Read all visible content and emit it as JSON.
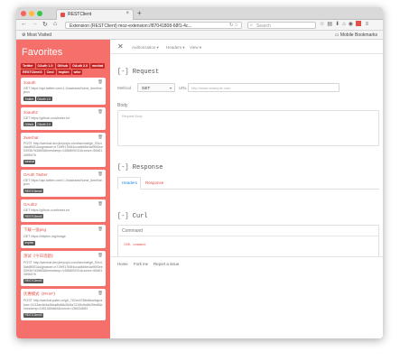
{
  "browser": {
    "tab_title": "RESTClient",
    "tab_close": "×",
    "new_tab": "+",
    "url": "Extension (RESTClient)   moz-extension://87041808-68f1-4c...",
    "search_placeholder": "Search",
    "bookmarks_left": "Most Visited",
    "bookmarks_right": "Mobile Bookmarks",
    "colors": {
      "close": "#fc605c",
      "minimize": "#fdbc40",
      "maximize": "#34c84a"
    }
  },
  "sidebar": {
    "title": "Favorites",
    "tags": [
      "Twitter",
      "OAuth 1.0",
      "Github",
      "OAuth 2.0",
      "wechat",
      "RESTClient3",
      "Cmd",
      "tmpbin",
      "wike"
    ],
    "items": [
      {
        "name": "3oauth",
        "desc": "GET https://api.twitter.com/1.1/statuses/home_timeline.json",
        "tags": [
          "Twitter",
          "OAuth 1.0"
        ]
      },
      {
        "name": "3oauth2",
        "desc": "GET https://github.com/index.txt",
        "tags": [
          "Github",
          "OAuth 2.0"
        ]
      },
      {
        "name": "3wechat",
        "desc": "POST http://wechat.dev.jimyrojiu.com/wechat/gh_93c45ab8f051&signature=e719f917b5f4ccad6b6e4a9f0f3ee0393b7d3d60&timestamp=1456809241&nonce=564613d9607b",
        "tags": [
          "wechat"
        ]
      },
      {
        "name": "OAuth Twitter",
        "desc": "GET https://api.twitter.com/1.1/statuses/home_timeline.json",
        "tags": [
          "RESTClient3"
        ]
      },
      {
        "name": "OAuth2",
        "desc": "GET https://github.com/index.txt",
        "tags": [
          "RESTClient3"
        ]
      },
      {
        "name": "下载一张png",
        "desc": "GET https://httpbin.org/image",
        "tags": [
          "tmpbin"
        ]
      },
      {
        "name": "测试《今日话题》",
        "desc": "POST http://wechat.dev.jimyrojiu.com/wechat/gh_93c45ab8f051&signature=e719f917b5f4ccad6b6e4a9f0f3ee0393b7d3d60&timestamp=1456809241&nonce=564613d9607b",
        "tags": [
          "RESTClient3"
        ]
      },
      {
        "name": "优惠模式《PAXF》",
        "desc": "POST http://wechat.pater.cn/gh_702ce478bb8ea/signature=3133ae4b9a36ea8b86b084fa7315fc5e8b2f9e8f&timestamp=1461384fa64&nonce=136034683",
        "tags": [
          "RESTClient3"
        ]
      }
    ]
  },
  "main": {
    "close_icon": "✕",
    "menu": {
      "authorization": "Authorization ▾",
      "headers": "Headers ▾",
      "view": "View ▾"
    },
    "request_title": "[-] Request",
    "method_label": "Method",
    "method_value": "GET",
    "url_label": "URL",
    "url_placeholder": "http://www.example.com",
    "body_label": "Body",
    "body_placeholder": "Request Body",
    "response_title": "[-] Response",
    "tab_headers": "Headers",
    "tab_response": "Response",
    "curl_title": "[-] Curl",
    "command_label": "Command",
    "command_text": "CURL command",
    "footer": {
      "home": "Home",
      "fork": "Fork me",
      "report": "Report a issue"
    }
  }
}
